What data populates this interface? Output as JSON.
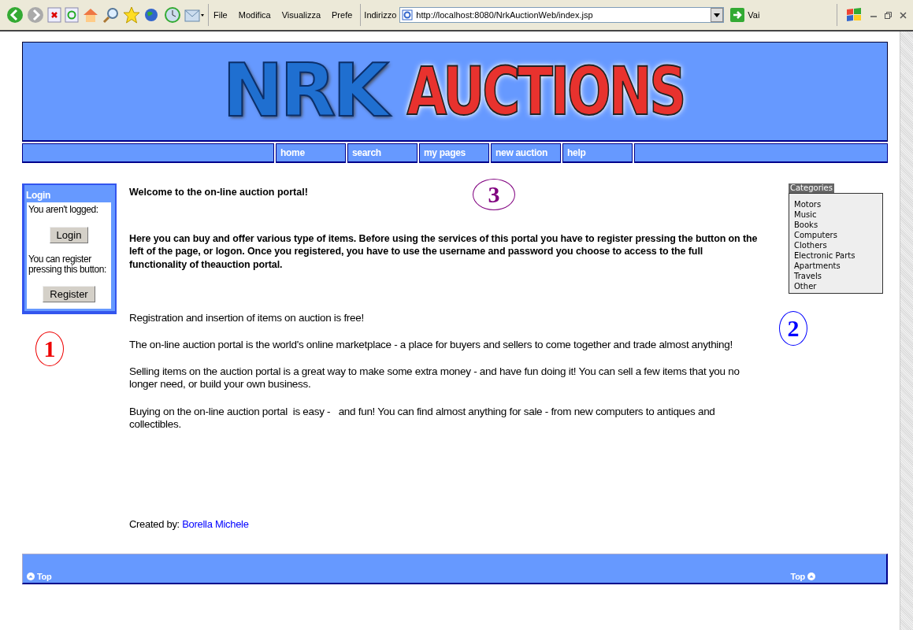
{
  "browser": {
    "menu": [
      "File",
      "Modifica",
      "Visualizza",
      "Prefe"
    ],
    "address_label": "Indirizzo",
    "url": "http://localhost:8080/NrkAuctionWeb/index.jsp",
    "go_label": "Vai"
  },
  "banner": {
    "logo_left": "NRK",
    "logo_right": "AUCTIONS"
  },
  "nav": [
    "home",
    "search",
    "my pages",
    "new auction",
    "help"
  ],
  "login": {
    "title": "Login",
    "status": "You aren't logged:",
    "login_button": "Login",
    "register_hint": "You can register pressing this button:",
    "register_button": "Register",
    "marker": "1"
  },
  "main": {
    "welcome": "Welcome to the on-line auction portal!",
    "intro": "Here you can buy and offer various type of items. Before using the services of this portal you have to register pressing the button on the left of the page, or logon. Once you registered, you have to use the username and password you choose to access to the full functionality of theauction portal.",
    "marker": "3",
    "paragraphs": [
      "Registration and insertion of items on auction is free!",
      "The on-line auction portal is the world's online marketplace - a place for buyers and sellers to come together and trade almost anything!",
      "Selling items on the auction portal is a great way to make some extra money - and have fun doing it! You can sell a few items that you no longer need, or build your own business.",
      "Buying on the on-line auction portal  is easy -   and fun! You can find almost anything for sale - from new computers to antiques and collectibles."
    ],
    "credit_label": "Created by:",
    "credit_link": "Borella Michele"
  },
  "categories": {
    "title": "Categories",
    "items": [
      "Motors",
      "Music",
      "Books",
      "Computers",
      "Clothers",
      "Electronic Parts",
      "Apartments",
      "Travels",
      "Other"
    ],
    "marker": "2"
  },
  "footer": {
    "left": "Top",
    "right": "Top"
  }
}
